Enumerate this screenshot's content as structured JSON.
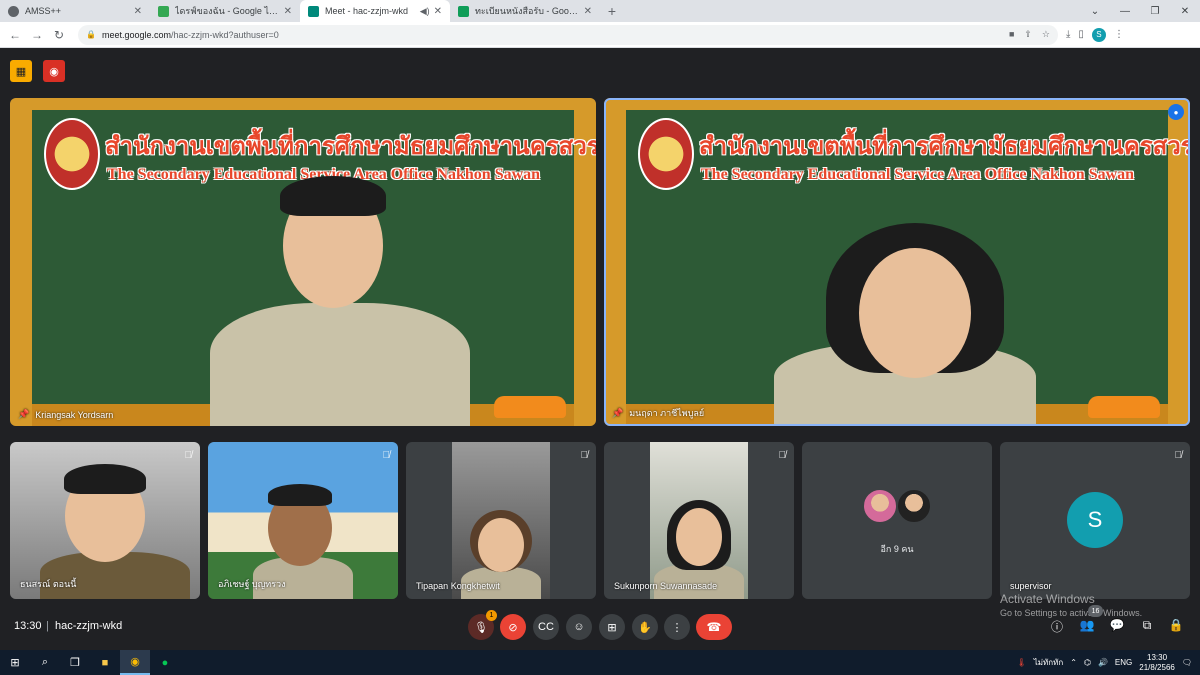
{
  "browser": {
    "tabs": [
      {
        "title": "AMSS++",
        "favicon_color": "#5f6368",
        "active": false
      },
      {
        "title": "ไดรฟ์ของฉัน - Google ไดรฟ์",
        "favicon_color": "#34a853",
        "active": false
      },
      {
        "title": "Meet - hac-zzjm-wkd",
        "favicon_color": "#00897b",
        "active": true
      },
      {
        "title": "ทะเบียนหนังสือรับ - Google ชีต",
        "favicon_color": "#0f9d58",
        "active": false
      }
    ],
    "url_host": "meet.google.com",
    "url_path": "/hac-zzjm-wkd?authuser=0",
    "profile_initial": "S"
  },
  "meet": {
    "board_title_th": "สำนักงานเขตพื้นที่การศึกษามัธยมศึกษานครสวรรค์",
    "board_title_en": "The Secondary Educational Service Area Office Nakhon Sawan",
    "main_tiles": [
      {
        "name": "Kriangsak Yordsarn"
      },
      {
        "name": "มนฤดา ภาชีไพบูลย์"
      }
    ],
    "small_tiles": [
      {
        "name": "ธนสรณ์ ตอนนี้"
      },
      {
        "name": "อภิเชษฐ์ บุญทรวง"
      },
      {
        "name": "Tipapan Kongkhetwit"
      },
      {
        "name": "Sukunporn Suwannasade"
      }
    ],
    "others_label": "อีก 9 คน",
    "supervisor": {
      "name": "supervisor",
      "initial": "S"
    },
    "meeting_time": "13:30",
    "meeting_code": "hac-zzjm-wkd",
    "notification_count": "1",
    "participant_count": "16",
    "watermark_line1": "Activate Windows",
    "watermark_line2": "Go to Settings to activate Windows."
  },
  "taskbar": {
    "weather": "ไม่ทักทัก",
    "language": "ENG",
    "time": "13:30",
    "date": "21/8/2566"
  },
  "colors": {
    "meet_bg": "#202124",
    "end_call": "#ea4335",
    "accent": "#8ab4f8",
    "avatar": "#129eaf"
  }
}
